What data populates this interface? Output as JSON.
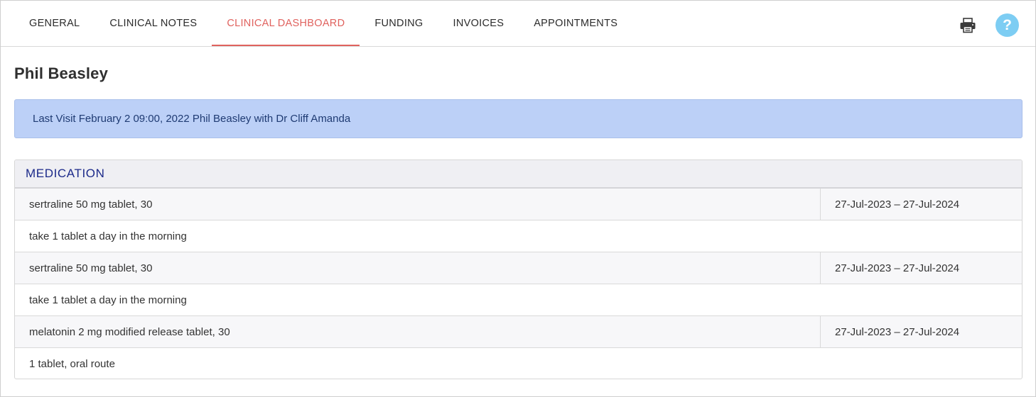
{
  "tabs": [
    {
      "label": "GENERAL",
      "active": false
    },
    {
      "label": "CLINICAL NOTES",
      "active": false
    },
    {
      "label": "CLINICAL DASHBOARD",
      "active": true
    },
    {
      "label": "FUNDING",
      "active": false
    },
    {
      "label": "INVOICES",
      "active": false
    },
    {
      "label": "APPOINTMENTS",
      "active": false
    }
  ],
  "toolbar": {
    "print_icon": "printer-icon",
    "help_label": "?"
  },
  "patient": {
    "name": "Phil Beasley"
  },
  "last_visit": {
    "text": "Last Visit February 2 09:00, 2022 Phil Beasley with Dr Cliff Amanda"
  },
  "medication": {
    "title": "MEDICATION",
    "items": [
      {
        "name": "sertraline 50 mg tablet, 30",
        "dates": "27-Jul-2023 – 27-Jul-2024",
        "instructions": "take 1 tablet a day in the morning"
      },
      {
        "name": "sertraline 50 mg tablet, 30",
        "dates": "27-Jul-2023 – 27-Jul-2024",
        "instructions": "take 1 tablet a day in the morning"
      },
      {
        "name": "melatonin 2 mg modified release tablet, 30",
        "dates": "27-Jul-2023 – 27-Jul-2024",
        "instructions": "1 tablet, oral route"
      }
    ]
  },
  "colors": {
    "accent": "#e0625e",
    "banner_bg": "#bcd0f7",
    "section_title": "#1c2a8a",
    "help_bg": "#7dcdf3"
  }
}
